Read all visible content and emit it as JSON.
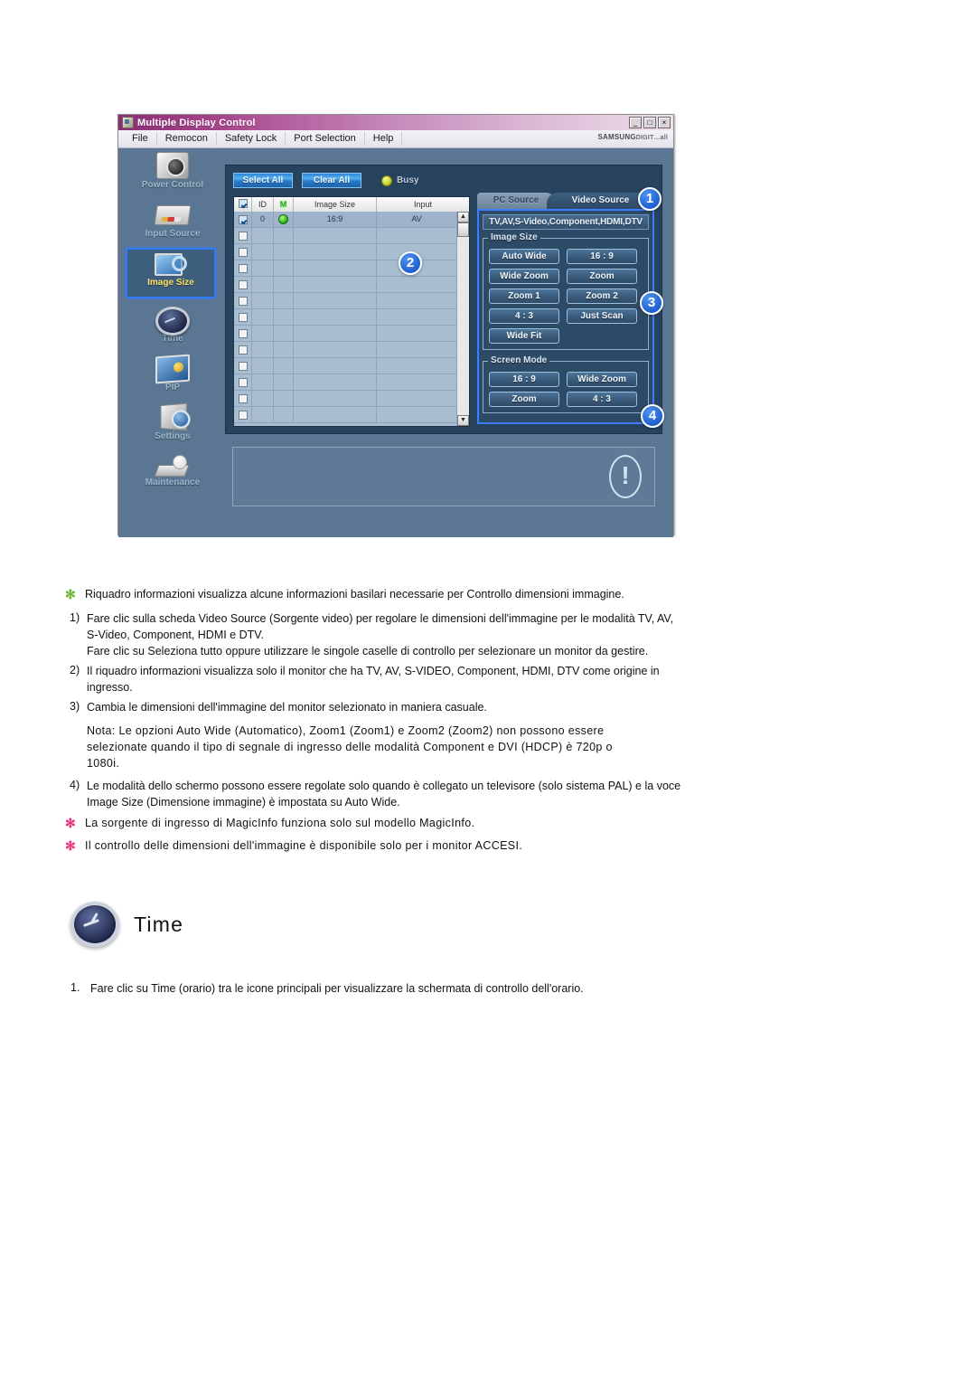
{
  "app": {
    "title": "Multiple Display Control",
    "brand": "SAMSUNG",
    "brand_sub": "DIGIT…all",
    "window_buttons": {
      "minimize": "_",
      "maximize": "□",
      "close": "×"
    },
    "menu": [
      "File",
      "Remocon",
      "Safety Lock",
      "Port Selection",
      "Help"
    ],
    "sidebar": [
      {
        "label": "Power Control",
        "icon": "power-control-icon",
        "selected": false
      },
      {
        "label": "Input Source",
        "icon": "input-source-icon",
        "selected": false
      },
      {
        "label": "Image Size",
        "icon": "image-size-icon",
        "selected": true
      },
      {
        "label": "Time",
        "icon": "clock-icon",
        "selected": false
      },
      {
        "label": "PIP",
        "icon": "pip-icon",
        "selected": false
      },
      {
        "label": "Settings",
        "icon": "settings-icon",
        "selected": false
      },
      {
        "label": "Maintenance",
        "icon": "maintenance-icon",
        "selected": false
      }
    ],
    "toolbar": {
      "select_all": "Select All",
      "clear_all": "Clear All",
      "status_label": "Busy",
      "status_led_color": "#d2db2a"
    },
    "table": {
      "columns": [
        "",
        "ID",
        "M",
        "Image Size",
        "Input"
      ],
      "rows": [
        {
          "checked": true,
          "id": "0",
          "led": "green",
          "image_size": "16:9",
          "input": "AV"
        },
        {
          "checked": false,
          "id": "",
          "led": "",
          "image_size": "",
          "input": ""
        },
        {
          "checked": false,
          "id": "",
          "led": "",
          "image_size": "",
          "input": ""
        },
        {
          "checked": false,
          "id": "",
          "led": "",
          "image_size": "",
          "input": ""
        },
        {
          "checked": false,
          "id": "",
          "led": "",
          "image_size": "",
          "input": ""
        },
        {
          "checked": false,
          "id": "",
          "led": "",
          "image_size": "",
          "input": ""
        },
        {
          "checked": false,
          "id": "",
          "led": "",
          "image_size": "",
          "input": ""
        },
        {
          "checked": false,
          "id": "",
          "led": "",
          "image_size": "",
          "input": ""
        },
        {
          "checked": false,
          "id": "",
          "led": "",
          "image_size": "",
          "input": ""
        },
        {
          "checked": false,
          "id": "",
          "led": "",
          "image_size": "",
          "input": ""
        },
        {
          "checked": false,
          "id": "",
          "led": "",
          "image_size": "",
          "input": ""
        },
        {
          "checked": false,
          "id": "",
          "led": "",
          "image_size": "",
          "input": ""
        },
        {
          "checked": false,
          "id": "",
          "led": "",
          "image_size": "",
          "input": ""
        }
      ],
      "scroll_up": "▲",
      "scroll_down": "▼"
    },
    "source_panel": {
      "tabs": [
        {
          "label": "PC Source",
          "active": false
        },
        {
          "label": "Video Source",
          "active": true
        }
      ],
      "header": "TV,AV,S-Video,Component,HDMI,DTV",
      "image_size_group": {
        "legend": "Image Size",
        "buttons": [
          "Auto Wide",
          "16 : 9",
          "Wide Zoom",
          "Zoom",
          "Zoom 1",
          "Zoom 2",
          "4 : 3",
          "Just Scan",
          "Wide Fit"
        ]
      },
      "screen_mode_group": {
        "legend": "Screen Mode",
        "buttons": [
          "16 : 9",
          "Wide Zoom",
          "Zoom",
          "4 : 3"
        ]
      }
    },
    "callouts": [
      "1",
      "2",
      "3",
      "4"
    ],
    "accent_blue": "#1d5fd0",
    "panel_bg": "#5a7693",
    "dark_panel_bg": "#27435e"
  },
  "doc": {
    "note_top": "Riquadro informazioni visualizza alcune informazioni basilari necessarie per Controllo dimensioni immagine.",
    "items": [
      {
        "num": "1)",
        "lines": [
          "Fare clic sulla scheda Video Source (Sorgente video) per regolare le dimensioni dell'immagine per le modalità TV, AV,",
          "S-Video, Component, HDMI e DTV.",
          "Fare clic su Seleziona tutto oppure utilizzare le singole caselle di controllo per selezionare un monitor da gestire."
        ]
      },
      {
        "num": "2)",
        "lines": [
          "Il riquadro informazioni visualizza solo il monitor che ha TV, AV, S-VIDEO, Component, HDMI, DTV come origine in",
          "ingresso."
        ]
      },
      {
        "num": "3)",
        "lines": [
          "Cambia le dimensioni dell'immagine del monitor selezionato in maniera casuale."
        ]
      }
    ],
    "nota": [
      "Nota: Le opzioni Auto Wide (Automatico), Zoom1 (Zoom1) e Zoom2 (Zoom2) non possono essere",
      "selezionate quando il tipo di segnale di ingresso delle modalità Component e DVI (HDCP) è 720p o",
      "1080i."
    ],
    "item4": {
      "num": "4)",
      "lines": [
        "Le modalità dello schermo possono essere regolate solo quando è collegato un televisore (solo sistema PAL) e la voce",
        "Image Size (Dimensione immagine) è impostata su Auto Wide."
      ]
    },
    "star_notes": [
      "La sorgente di ingresso di MagicInfo funziona solo sul modello MagicInfo.",
      "Il controllo delle dimensioni dell'immagine è disponibile solo per i monitor ACCESI."
    ],
    "star_glyph": "✻",
    "time_section": {
      "title": "Time",
      "step_num": "1.",
      "step_text": "Fare clic su Time (orario) tra le icone principali per visualizzare la schermata di controllo dell'orario."
    }
  }
}
